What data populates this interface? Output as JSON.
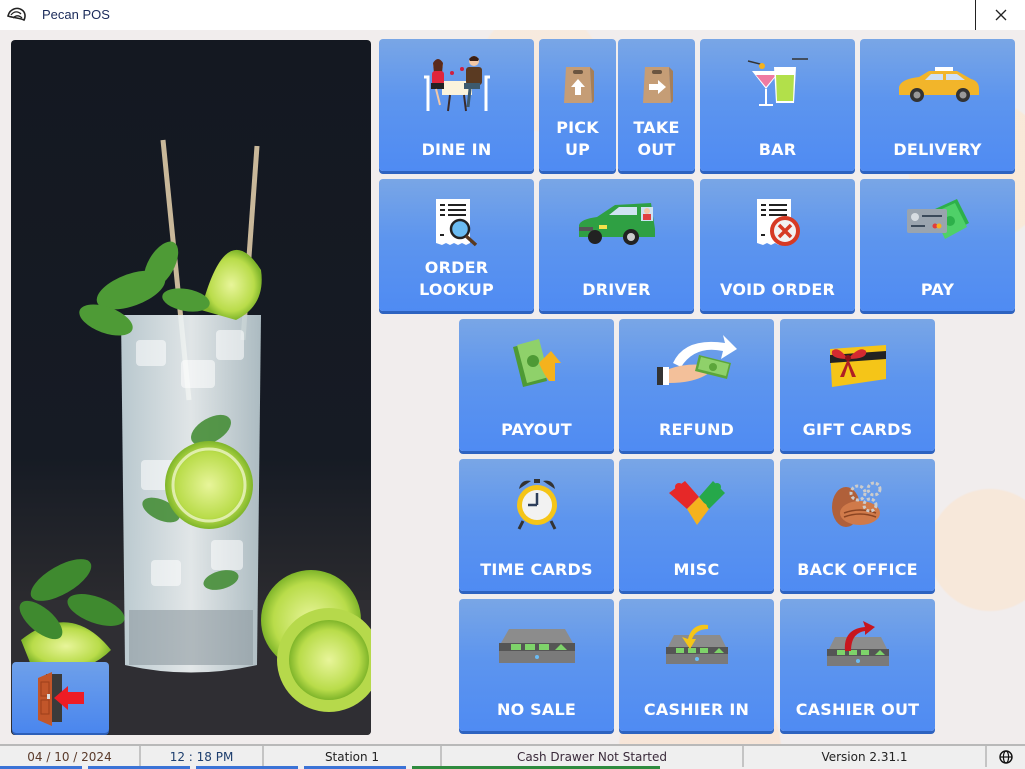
{
  "window": {
    "title": "Pecan POS",
    "app_icon": "pecan-logo-icon",
    "close_icon": "close-icon"
  },
  "exit_button": {
    "icon": "exit-door-icon",
    "label": "Exit"
  },
  "tiles": [
    {
      "id": "dine-in",
      "label": "DINE IN",
      "icon": "dine-in-icon"
    },
    {
      "id": "pick-up",
      "label": "PICK UP",
      "icon": "pickup-bag-icon"
    },
    {
      "id": "take-out",
      "label": "TAKE OUT",
      "icon": "takeout-bag-icon"
    },
    {
      "id": "bar",
      "label": "BAR",
      "icon": "cocktail-icon"
    },
    {
      "id": "delivery",
      "label": "DELIVERY",
      "icon": "taxi-icon"
    },
    {
      "id": "order-lookup",
      "label": "ORDER LOOKUP",
      "icon": "receipt-search-icon"
    },
    {
      "id": "driver",
      "label": "DRIVER",
      "icon": "driver-car-icon"
    },
    {
      "id": "void-order",
      "label": "VOID ORDER",
      "icon": "receipt-void-icon"
    },
    {
      "id": "pay",
      "label": "PAY",
      "icon": "card-cash-icon"
    },
    {
      "id": "payout",
      "label": "PAYOUT",
      "icon": "cash-out-icon"
    },
    {
      "id": "refund",
      "label": "REFUND",
      "icon": "refund-hand-icon"
    },
    {
      "id": "gift-cards",
      "label": "GIFT CARDS",
      "icon": "gift-card-icon"
    },
    {
      "id": "time-cards",
      "label": "TIME CARDS",
      "icon": "alarm-clock-icon"
    },
    {
      "id": "misc",
      "label": "MISC",
      "icon": "puzzle-icon"
    },
    {
      "id": "back-office",
      "label": "BACK OFFICE",
      "icon": "pecan-gears-icon"
    },
    {
      "id": "no-sale",
      "label": "NO SALE",
      "icon": "cash-drawer-icon"
    },
    {
      "id": "cashier-in",
      "label": "CASHIER IN",
      "icon": "cash-drawer-in-icon"
    },
    {
      "id": "cashier-out",
      "label": "CASHIER OUT",
      "icon": "cash-drawer-out-icon"
    }
  ],
  "pickup_lines": [
    "PICK",
    "UP"
  ],
  "takeout_lines": [
    "TAKE",
    "OUT"
  ],
  "orderlookup_lines": [
    "ORDER",
    "LOOKUP"
  ],
  "status": {
    "date": "04 / 10 / 2024",
    "time": "12 : 18 PM",
    "station": "Station 1",
    "drawer": "Cash Drawer Not Started",
    "version": "Version 2.31.1",
    "language_icon": "globe-icon"
  },
  "colors": {
    "tile_top": "#79a6e6",
    "tile_bottom": "#4f8bf3",
    "tile_shadow": "#2e63c0",
    "status_strip_blue": "#3b73d6",
    "status_strip_green": "#2e8b3e"
  }
}
